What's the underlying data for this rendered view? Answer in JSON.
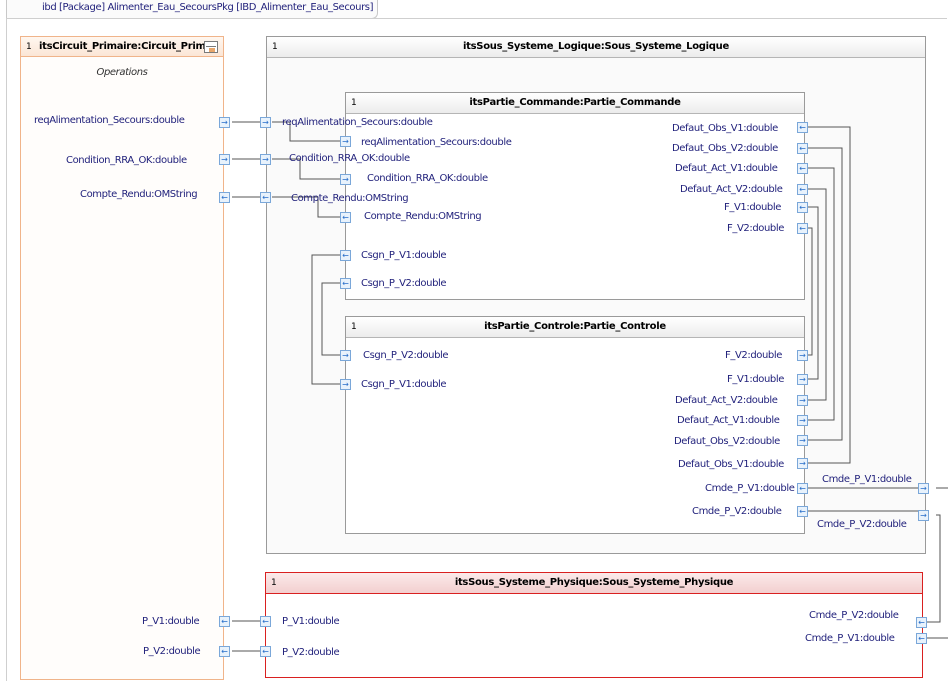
{
  "tab": {
    "title": "ibd [Package] Alimenter_Eau_SecoursPkg [IBD_Alimenter_Eau_Secours]"
  },
  "circuit": {
    "mult": "1",
    "title": "itsCircuit_Primaire:Circuit_Prim",
    "section": "Operations",
    "ports": {
      "req": "reqAlimentation_Secours:double",
      "cond": "Condition_RRA_OK:double",
      "compte": "Compte_Rendu:OMString",
      "pv1": "P_V1:double",
      "pv2": "P_V2:double"
    }
  },
  "logique": {
    "mult": "1",
    "title": "itsSous_Systeme_Logique:Sous_Systeme_Logique",
    "ports_left": {
      "req": "reqAlimentation_Secours:double",
      "cond": "Condition_RRA_OK:double",
      "compte": "Compte_Rendu:OMString"
    },
    "ports_right": {
      "cmde_v1": "Cmde_P_V1:double",
      "cmde_v2": "Cmde_P_V2:double"
    }
  },
  "commande": {
    "mult": "1",
    "title": "itsPartie_Commande:Partie_Commande",
    "left": {
      "req": "reqAlimentation_Secours:double",
      "cond": "Condition_RRA_OK:double",
      "compte": "Compte_Rendu:OMString",
      "csgn_v1": "Csgn_P_V1:double",
      "csgn_v2": "Csgn_P_V2:double"
    },
    "right": {
      "obs_v1": "Defaut_Obs_V1:double",
      "obs_v2": "Defaut_Obs_V2:double",
      "act_v1": "Defaut_Act_V1:double",
      "act_v2": "Defaut_Act_V2:double",
      "f_v1": "F_V1:double",
      "f_v2": "F_V2:double"
    }
  },
  "controle": {
    "mult": "1",
    "title": "itsPartie_Controle:Partie_Controle",
    "left": {
      "csgn_v2": "Csgn_P_V2:double",
      "csgn_v1": "Csgn_P_V1:double"
    },
    "right": {
      "f_v2": "F_V2:double",
      "f_v1": "F_V1:double",
      "act_v2": "Defaut_Act_V2:double",
      "act_v1": "Defaut_Act_V1:double",
      "obs_v2": "Defaut_Obs_V2:double",
      "obs_v1": "Defaut_Obs_V1:double",
      "cmde_v1": "Cmde_P_V1:double",
      "cmde_v2": "Cmde_P_V2:double"
    }
  },
  "physique": {
    "mult": "1",
    "title": "itsSous_Systeme_Physique:Sous_Systeme_Physique",
    "left": {
      "pv1": "P_V1:double",
      "pv2": "P_V2:double"
    },
    "right": {
      "cmde_v2": "Cmde_P_V2:double",
      "cmde_v1": "Cmde_P_V1:double"
    }
  },
  "icons": {
    "port_in": "arrow-right",
    "port_out": "arrow-left"
  },
  "colors": {
    "circuit_border": "#f0b48a",
    "physique_border": "#d92020",
    "physique_header": "#f7d6d6",
    "label": "#1f1f7a",
    "port": "#2a6fc9"
  }
}
